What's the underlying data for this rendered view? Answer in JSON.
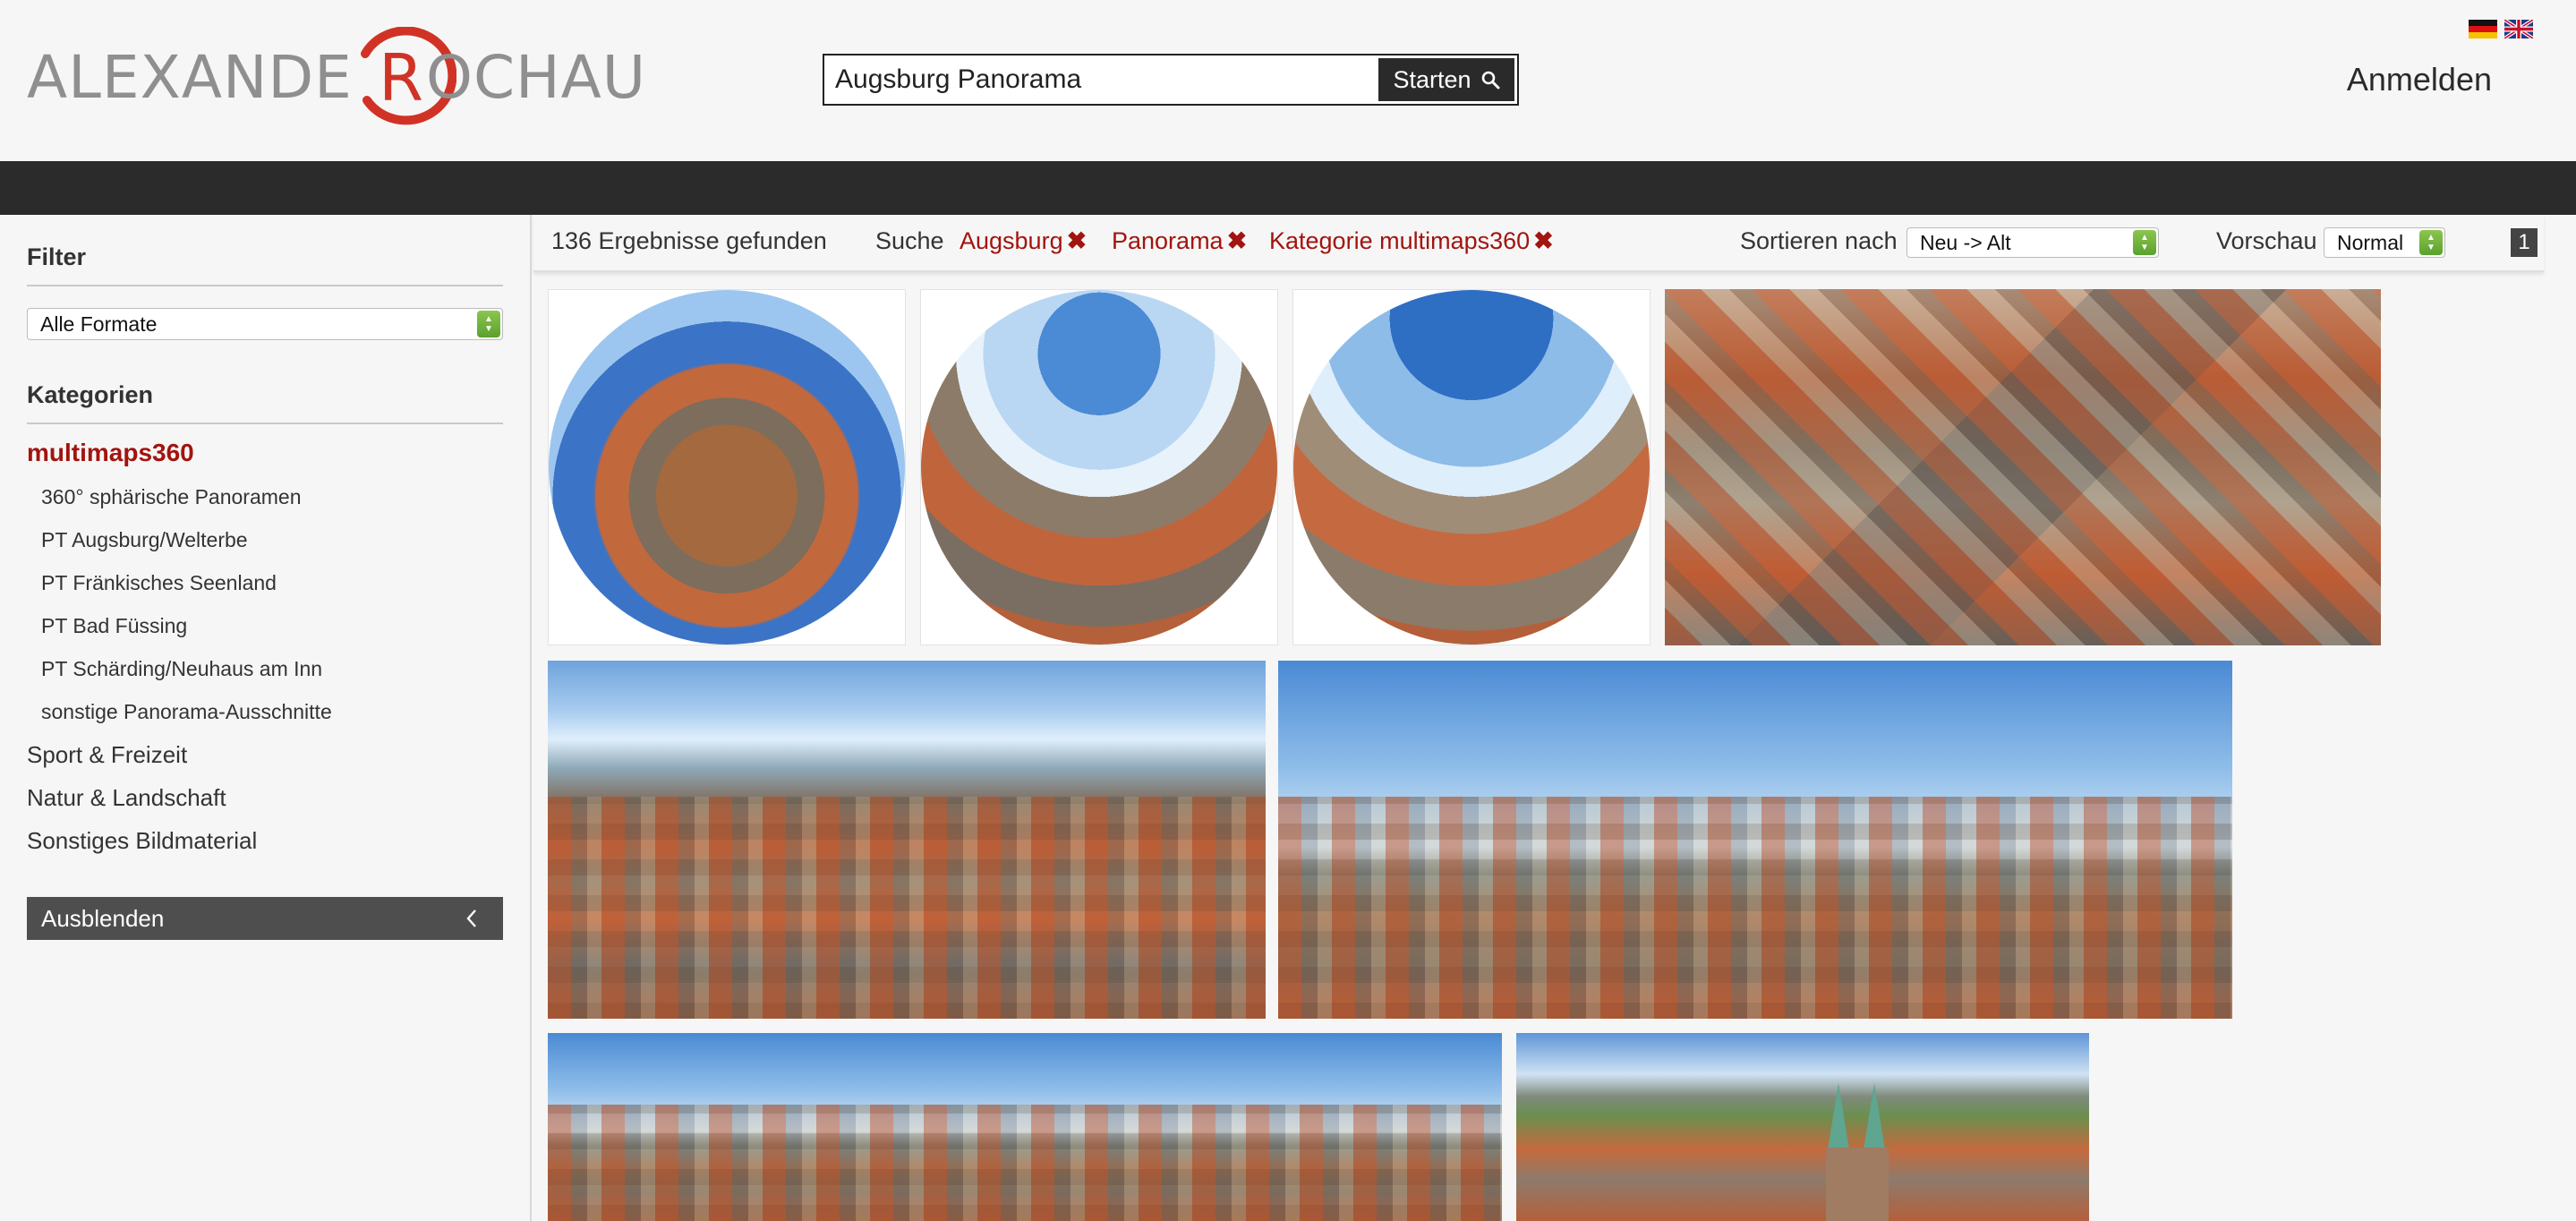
{
  "header": {
    "logo_text_left": "ALEXANDE",
    "logo_letter": "R",
    "logo_text_right": "OCHAU",
    "search": {
      "value": "Augsburg Panorama",
      "button_label": "Starten"
    },
    "login_label": "Anmelden",
    "languages": [
      "de-flag-icon",
      "uk-flag-icon"
    ]
  },
  "sidebar": {
    "filter_title": "Filter",
    "format_select": "Alle Formate",
    "categories_title": "Kategorien",
    "active_category": "multimaps360",
    "subcategories": [
      "360° sphärische Panoramen",
      "PT Augsburg/Welterbe",
      "PT Fränkisches Seenland",
      "PT Bad Füssing",
      "PT Schärding/Neuhaus am Inn",
      "sonstige Panorama-Ausschnitte"
    ],
    "categories": [
      "Sport & Freizeit",
      "Natur & Landschaft",
      "Sonstiges Bildmaterial"
    ],
    "hide_label": "Ausblenden"
  },
  "results": {
    "count_text": "136 Ergebnisse gefunden",
    "search_label": "Suche",
    "tags": [
      "Augsburg",
      "Panorama",
      "Kategorie multimaps360"
    ],
    "sort_label": "Sortieren nach",
    "sort_value": "Neu -> Alt",
    "preview_label": "Vorschau",
    "preview_value": "Normal",
    "page": "1"
  },
  "thumbnails": [
    "little-planet-panorama",
    "fisheye-sphere-panorama",
    "fisheye-sphere-panorama",
    "aerial-town-hall",
    "aerial-panorama-town-hall",
    "aerial-panorama-city",
    "aerial-panorama-skyline",
    "aerial-panorama-cathedral"
  ],
  "colors": {
    "accent_red": "#a2140f",
    "dark_bar": "#2b2b2b",
    "select_green": "#5aa12e"
  }
}
